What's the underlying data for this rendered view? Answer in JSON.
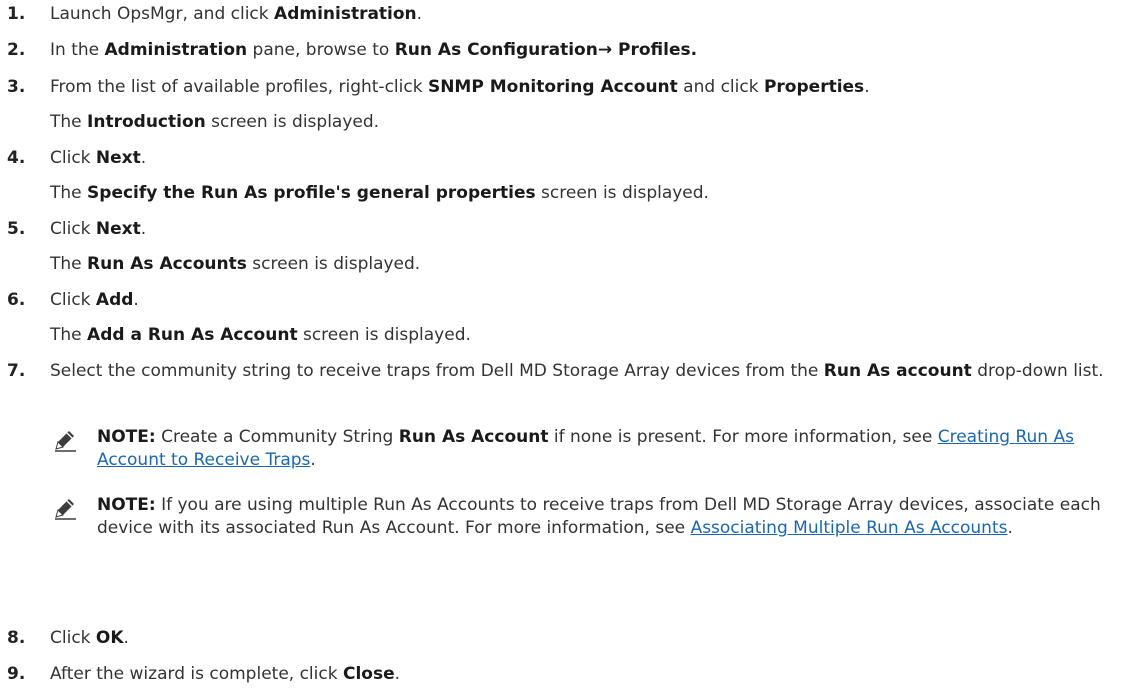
{
  "steps": [
    {
      "num": "1.",
      "parts": [
        "Launch OpsMgr, and click ",
        "Administration",
        "."
      ]
    },
    {
      "num": "2.",
      "parts": [
        "In the ",
        "Administration",
        " pane, browse to ",
        "Run As Configuration→ Profiles."
      ]
    },
    {
      "num": "3.",
      "parts": [
        "From the list of available profiles, right-click ",
        "SNMP Monitoring Account",
        " and click ",
        "Properties",
        "."
      ],
      "result": [
        "The ",
        "Introduction",
        " screen is displayed."
      ]
    },
    {
      "num": "4.",
      "parts": [
        "Click ",
        "Next",
        "."
      ],
      "result": [
        "The ",
        "Specify the Run As profile's general properties",
        " screen is displayed."
      ]
    },
    {
      "num": "5.",
      "parts": [
        "Click ",
        "Next",
        "."
      ],
      "result": [
        "The ",
        "Run As Accounts",
        " screen is displayed."
      ]
    },
    {
      "num": "6.",
      "parts": [
        "Click ",
        "Add",
        "."
      ],
      "result": [
        "The ",
        "Add a Run As Account",
        " screen is displayed."
      ]
    },
    {
      "num": "7.",
      "parts": [
        "Select the community string to receive traps from Dell MD Storage Array devices from the ",
        "Run As account",
        " drop-down list."
      ],
      "notes": [
        {
          "label": "NOTE:",
          "parts": [
            " Create a Community String ",
            "Run As Account",
            " if none is present. For more information, see "
          ],
          "link": "Creating Run As Account to Receive Traps",
          "tail": "."
        },
        {
          "label": "NOTE:",
          "parts": [
            " If you are using multiple Run As Accounts to receive traps from Dell MD Storage Array devices, associate each device with its associated Run As Account. For more information, see "
          ],
          "link": "Associating Multiple Run As Accounts",
          "tail": "."
        }
      ]
    },
    {
      "num": "8.",
      "parts": [
        "Click ",
        "OK",
        "."
      ]
    },
    {
      "num": "9.",
      "parts": [
        "After the wizard is complete, click ",
        "Close",
        "."
      ]
    }
  ],
  "icons": {
    "note": "pencil-note-icon"
  },
  "colors": {
    "text": "#333333",
    "link": "#1a66b3"
  }
}
